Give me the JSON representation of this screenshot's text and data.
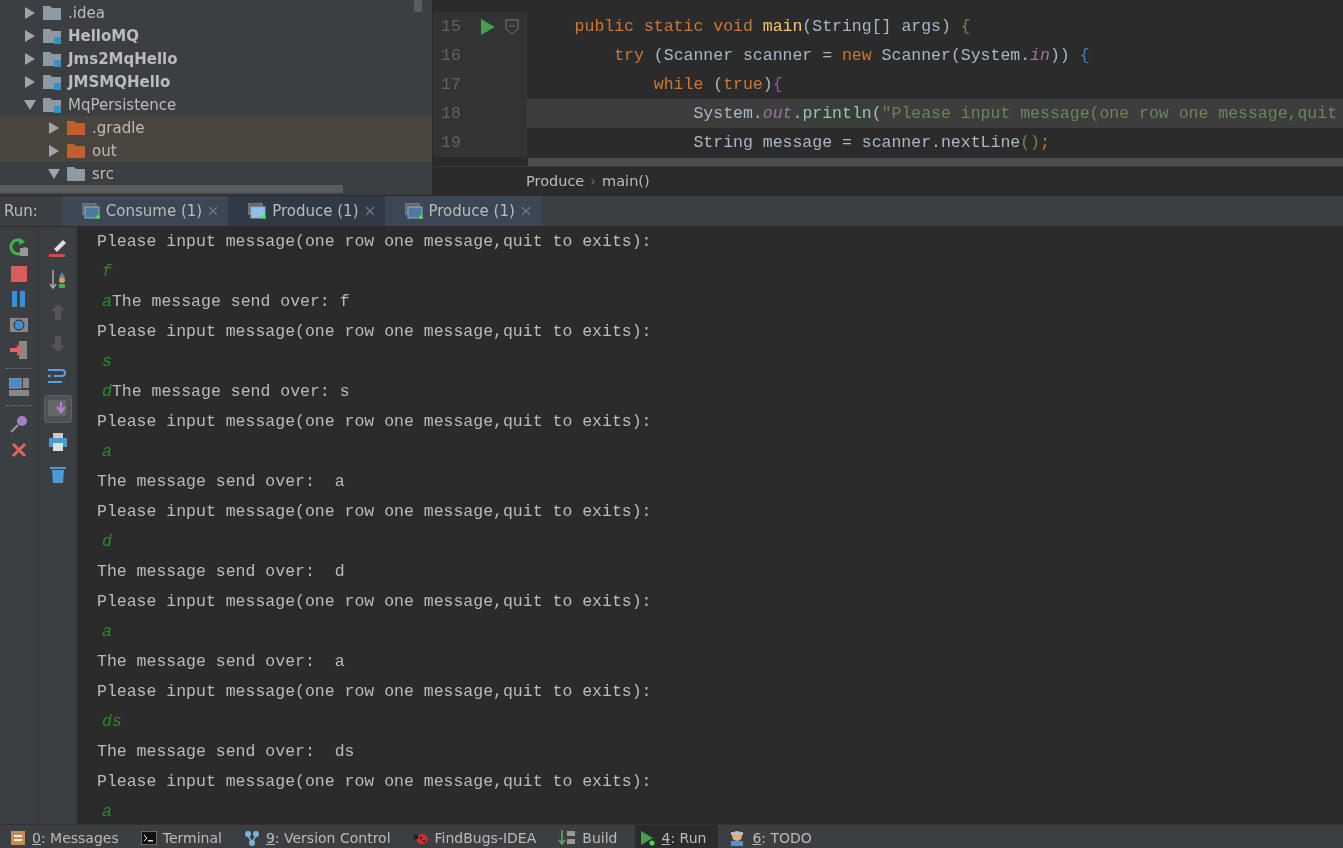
{
  "project_tree": {
    "items": [
      {
        "label": ".idea",
        "kind": "folder",
        "bold": false,
        "expanded": false
      },
      {
        "label": "HelloMQ",
        "kind": "module",
        "bold": true,
        "expanded": false
      },
      {
        "label": "Jms2MqHello",
        "kind": "module",
        "bold": true,
        "expanded": false
      },
      {
        "label": "JMSMQHello",
        "kind": "module",
        "bold": true,
        "expanded": false
      },
      {
        "label": "MqPersistence",
        "kind": "module",
        "bold": false,
        "expanded": true,
        "children": [
          {
            "label": ".gradle",
            "kind": "excluded",
            "bold": false,
            "expanded": false
          },
          {
            "label": "out",
            "kind": "excluded",
            "bold": false,
            "expanded": false
          },
          {
            "label": "src",
            "kind": "folder",
            "bold": false,
            "expanded": true
          }
        ]
      }
    ]
  },
  "editor": {
    "lines": [
      {
        "number": "15",
        "run_marker": true,
        "fold_marker": true,
        "current": false,
        "tokens": [
          {
            "kind": "keyword",
            "text": "    public static void "
          },
          {
            "kind": "method",
            "text": "main"
          },
          {
            "kind": "plain",
            "text": "(String[] args) "
          },
          {
            "kind": "brace",
            "text": "{"
          }
        ]
      },
      {
        "number": "16",
        "run_marker": false,
        "fold_marker": false,
        "current": false,
        "tokens": [
          {
            "kind": "keyword",
            "text": "        try "
          },
          {
            "kind": "plain",
            "text": "(Scanner scanner = "
          },
          {
            "kind": "keyword",
            "text": "new "
          },
          {
            "kind": "plain",
            "text": "Scanner(System."
          },
          {
            "kind": "field",
            "text": "in"
          },
          {
            "kind": "plain",
            "text": ")) "
          },
          {
            "kind": "brace2",
            "text": "{"
          }
        ]
      },
      {
        "number": "17",
        "run_marker": false,
        "fold_marker": false,
        "current": false,
        "tokens": [
          {
            "kind": "keyword",
            "text": "            while "
          },
          {
            "kind": "plain",
            "text": "("
          },
          {
            "kind": "keyword",
            "text": "true"
          },
          {
            "kind": "plain",
            "text": ")"
          },
          {
            "kind": "brace3",
            "text": "{"
          }
        ]
      },
      {
        "number": "18",
        "run_marker": false,
        "fold_marker": false,
        "current": true,
        "tokens": [
          {
            "kind": "plain",
            "text": "                System."
          },
          {
            "kind": "field",
            "text": "out"
          },
          {
            "kind": "plain",
            "text": "."
          },
          {
            "kind": "usage",
            "text": "println"
          },
          {
            "kind": "plain",
            "text": "("
          },
          {
            "kind": "string",
            "text": "\"Please input message(one row one message,quit"
          }
        ]
      },
      {
        "number": "19",
        "run_marker": false,
        "fold_marker": false,
        "current": false,
        "tokens": [
          {
            "kind": "plain",
            "text": "                String message = scanner.nextLine"
          },
          {
            "kind": "brace",
            "text": "()"
          },
          {
            "kind": "keyword",
            "text": ";"
          }
        ]
      }
    ],
    "breadcrumb": [
      "Produce",
      "›",
      "main()"
    ]
  },
  "run_panel": {
    "label": "Run:",
    "tabs": [
      {
        "label": "Consume (1)",
        "selected": false
      },
      {
        "label": "Produce (1)",
        "selected": true
      },
      {
        "label": "Produce (1)",
        "selected": false
      }
    ],
    "scroll_to_end": true,
    "console": [
      [
        {
          "kind": "output",
          "text": "Please input message(one row one message,quit to exits):"
        }
      ],
      [
        {
          "kind": "input",
          "text": "f"
        }
      ],
      [
        {
          "kind": "input",
          "text": "a"
        },
        {
          "kind": "output",
          "text": "The message send over: f"
        }
      ],
      [
        {
          "kind": "output",
          "text": "Please input message(one row one message,quit to exits):"
        }
      ],
      [
        {
          "kind": "input",
          "text": "s"
        }
      ],
      [
        {
          "kind": "input",
          "text": "d"
        },
        {
          "kind": "output",
          "text": "The message send over: s"
        }
      ],
      [
        {
          "kind": "output",
          "text": "Please input message(one row one message,quit to exits):"
        }
      ],
      [
        {
          "kind": "input",
          "text": "a"
        }
      ],
      [
        {
          "kind": "output",
          "text": "The message send over:  a"
        }
      ],
      [
        {
          "kind": "output",
          "text": "Please input message(one row one message,quit to exits):"
        }
      ],
      [
        {
          "kind": "input",
          "text": "d"
        }
      ],
      [
        {
          "kind": "output",
          "text": "The message send over:  d"
        }
      ],
      [
        {
          "kind": "output",
          "text": "Please input message(one row one message,quit to exits):"
        }
      ],
      [
        {
          "kind": "input",
          "text": "a"
        }
      ],
      [
        {
          "kind": "output",
          "text": "The message send over:  a"
        }
      ],
      [
        {
          "kind": "output",
          "text": "Please input message(one row one message,quit to exits):"
        }
      ],
      [
        {
          "kind": "input",
          "text": "ds"
        }
      ],
      [
        {
          "kind": "output",
          "text": "The message send over:  ds"
        }
      ],
      [
        {
          "kind": "output",
          "text": "Please input message(one row one message,quit to exits):"
        }
      ],
      [
        {
          "kind": "input",
          "text": "a"
        }
      ]
    ]
  },
  "tool_windows": [
    {
      "kind": "messages",
      "mnemonic": "0",
      "label": ": Messages",
      "selected": false
    },
    {
      "kind": "terminal",
      "label": "Terminal",
      "selected": false
    },
    {
      "kind": "vcs",
      "mnemonic": "9",
      "label": ": Version Control",
      "selected": false
    },
    {
      "kind": "findbugs",
      "label": "FindBugs-IDEA",
      "selected": false
    },
    {
      "kind": "build",
      "label": "Build",
      "selected": false
    },
    {
      "kind": "run",
      "mnemonic": "4",
      "label": ": Run",
      "selected": true
    },
    {
      "kind": "todo",
      "mnemonic": "6",
      "label": ": TODO",
      "selected": false
    }
  ]
}
